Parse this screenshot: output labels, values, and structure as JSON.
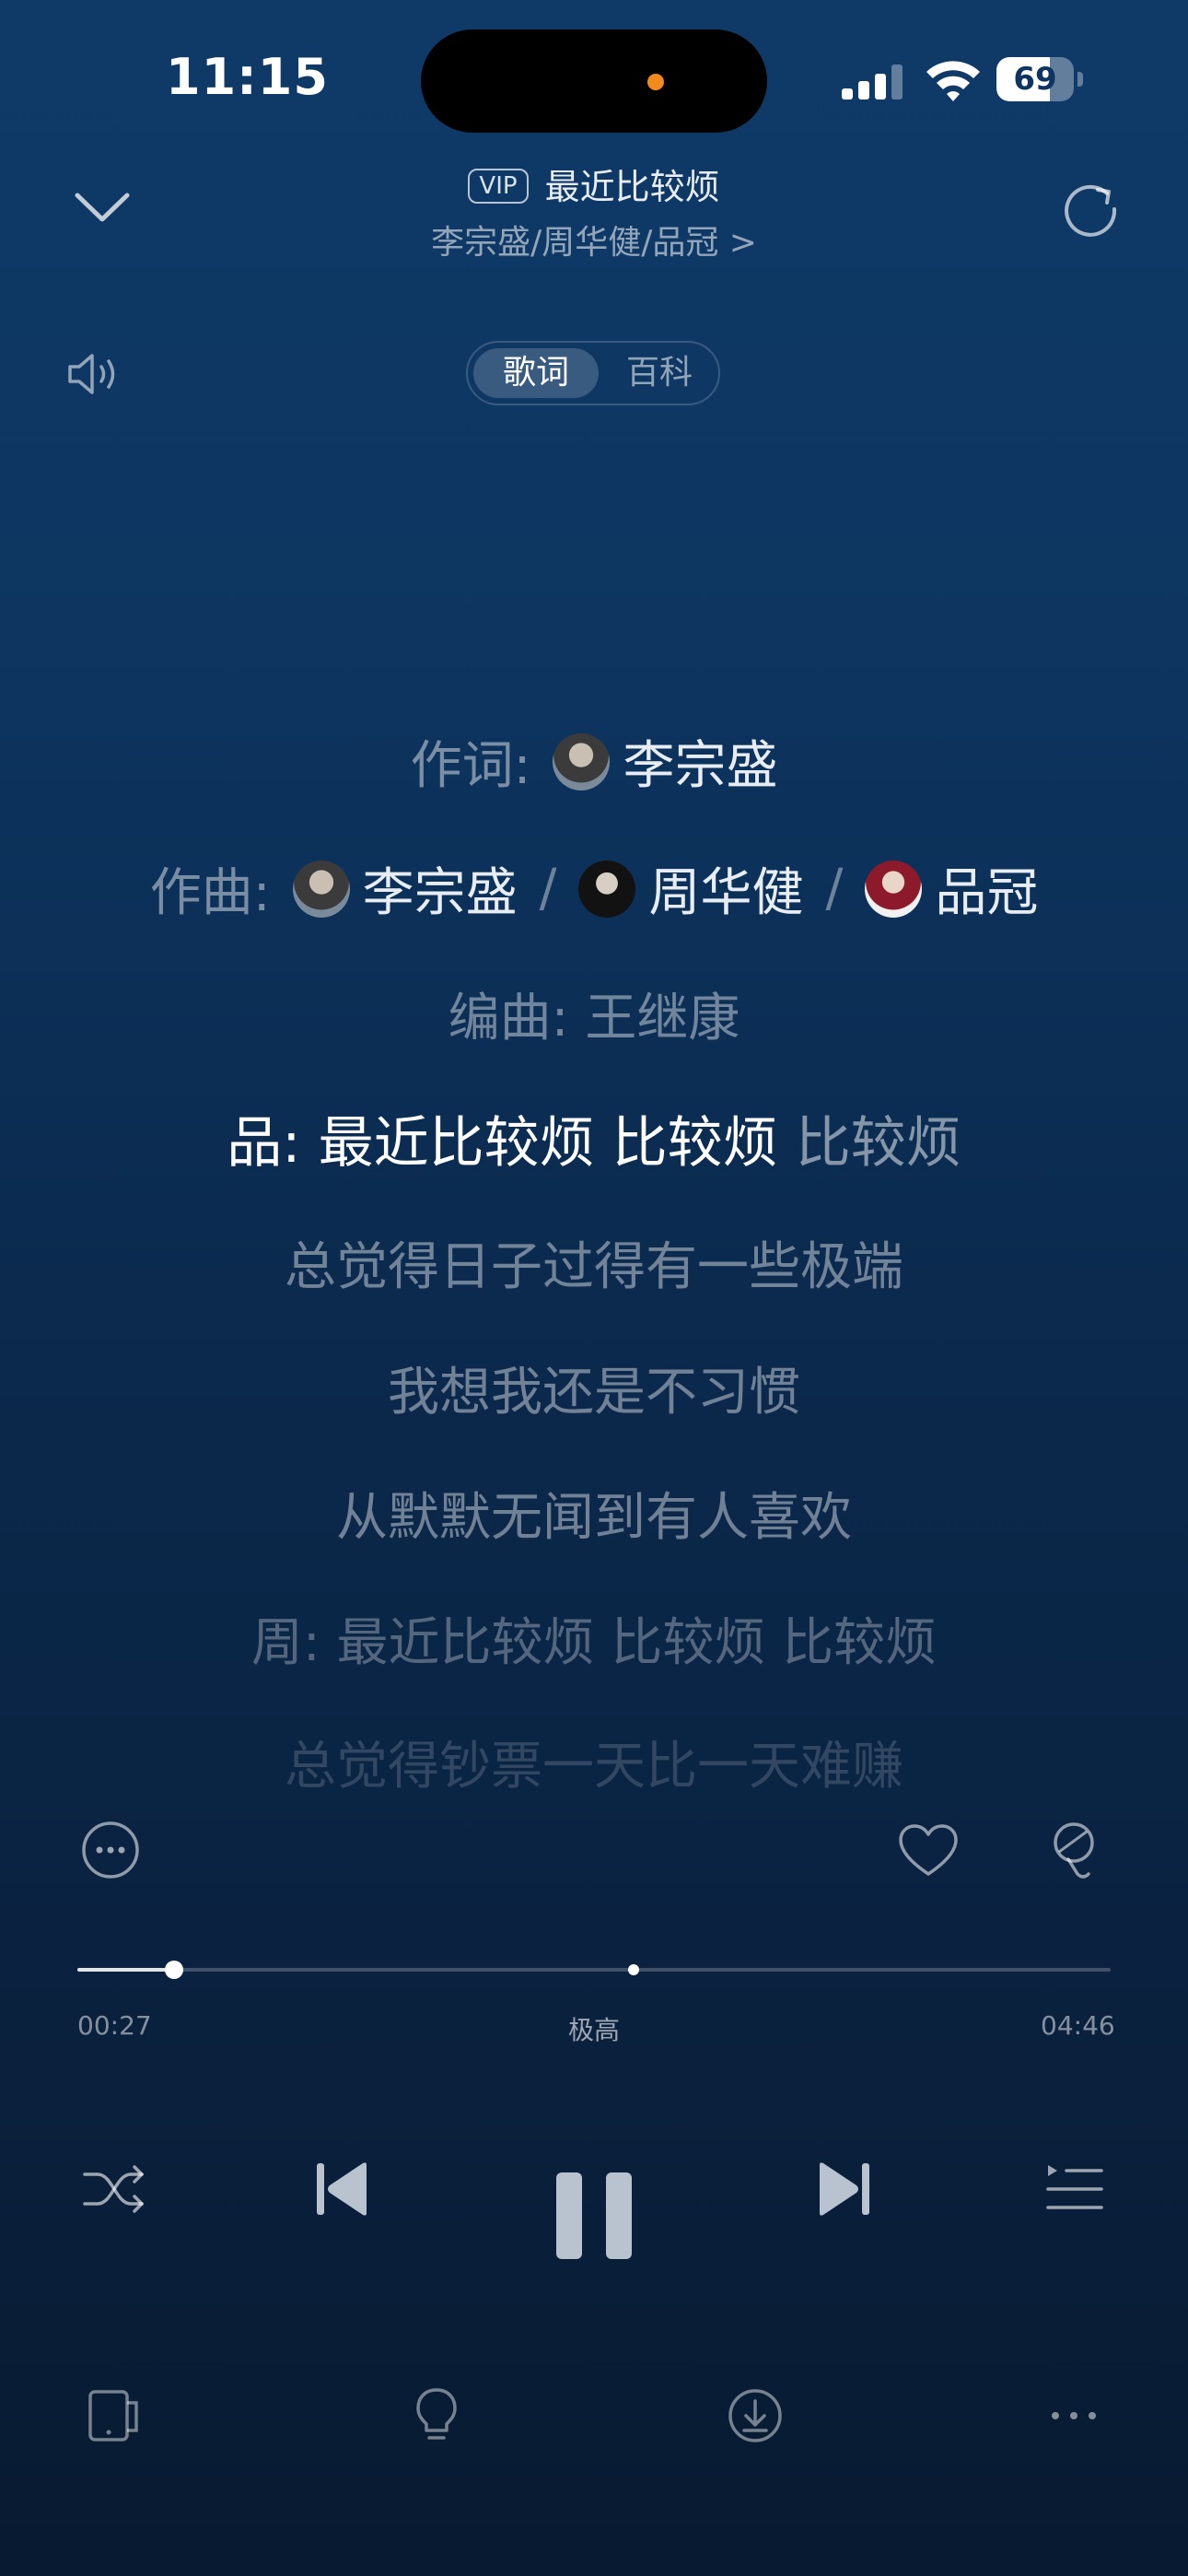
{
  "status_bar": {
    "time": "11:15",
    "battery": "69",
    "battery_level_percent": 69
  },
  "header": {
    "vip_badge": "VIP",
    "song_title": "最近比较烦",
    "artists": "李宗盛/周华健/品冠 >"
  },
  "tabs": {
    "active": "歌词",
    "inactive": "百科"
  },
  "credits": {
    "lyricist_label": "作词:",
    "lyricist": "李宗盛",
    "composer_label": "作曲:",
    "composers": [
      "李宗盛",
      "周华健",
      "品冠"
    ],
    "separator": "/",
    "arranger_line": "编曲: 王继康"
  },
  "lyrics": {
    "current_sung": "品: 最近比较烦 比较烦 ",
    "current_rest": "比较烦",
    "upcoming": [
      "总觉得日子过得有一些极端",
      "我想我还是不习惯",
      "从默默无闻到有人喜欢",
      "周: 最近比较烦 比较烦 比较烦",
      "总觉得钞票一天比一天难赚"
    ]
  },
  "progress": {
    "current": "00:27",
    "total": "04:46",
    "quality": "极高",
    "played_fraction": 0.094
  },
  "icons": [
    "chevron-down-icon",
    "refresh-icon",
    "speaker-icon",
    "more-circle-icon",
    "heart-icon",
    "mic-icon",
    "shuffle-icon",
    "prev-icon",
    "pause-icon",
    "next-icon",
    "queue-icon",
    "device-icon",
    "bulb-icon",
    "download-icon",
    "more-dots-icon"
  ],
  "colors": {
    "accent": "#f28a1b",
    "background_top": "#0f3a68",
    "background_bottom": "#081a31"
  }
}
